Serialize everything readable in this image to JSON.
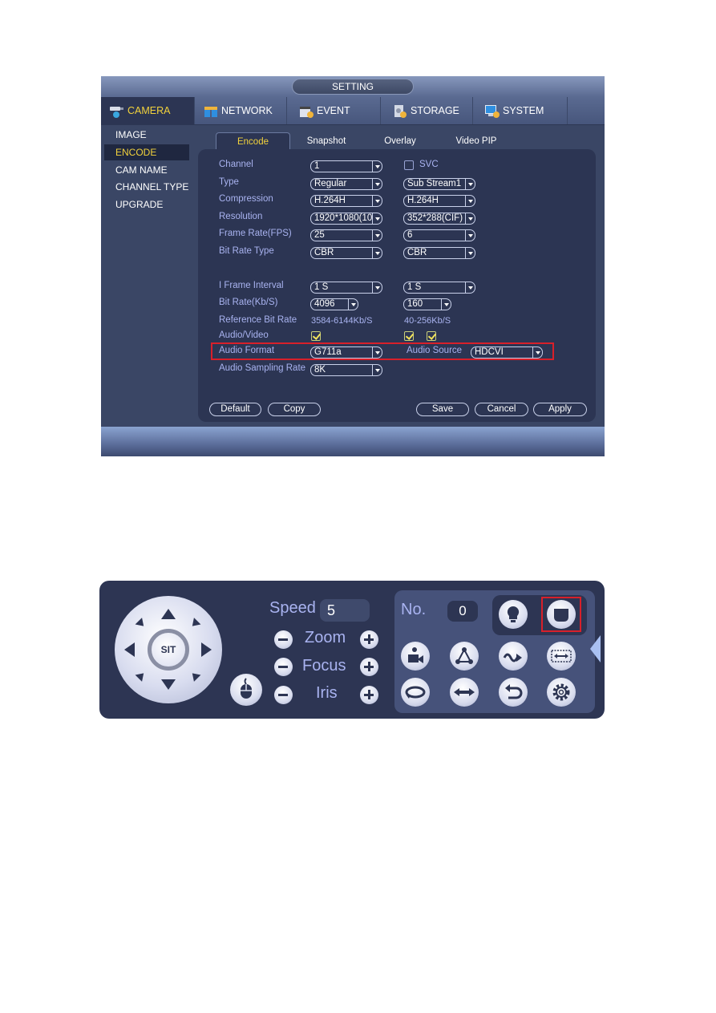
{
  "setting_window": {
    "title": "SETTING",
    "menu_tabs": [
      {
        "label": "CAMERA",
        "icon": "camera-icon",
        "active": true
      },
      {
        "label": "NETWORK",
        "icon": "network-icon",
        "active": false
      },
      {
        "label": "EVENT",
        "icon": "event-icon",
        "active": false
      },
      {
        "label": "STORAGE",
        "icon": "storage-icon",
        "active": false
      },
      {
        "label": "SYSTEM",
        "icon": "system-icon",
        "active": false
      }
    ],
    "sidebar": [
      {
        "label": "IMAGE",
        "active": false
      },
      {
        "label": "ENCODE",
        "active": true
      },
      {
        "label": "CAM NAME",
        "active": false
      },
      {
        "label": "CHANNEL TYPE",
        "active": false
      },
      {
        "label": "UPGRADE",
        "active": false
      }
    ],
    "sub_tabs": [
      {
        "label": "Encode",
        "active": true
      },
      {
        "label": "Snapshot",
        "active": false
      },
      {
        "label": "Overlay",
        "active": false
      },
      {
        "label": "Video PIP",
        "active": false
      }
    ],
    "form": {
      "channel": {
        "label": "Channel",
        "value": "1"
      },
      "svc": {
        "label": "SVC",
        "checked": false
      },
      "type": {
        "label": "Type",
        "main": "Regular",
        "sub": "Sub Stream1"
      },
      "compression": {
        "label": "Compression",
        "main": "H.264H",
        "sub": "H.264H"
      },
      "resolution": {
        "label": "Resolution",
        "main": "1920*1080(10",
        "sub": "352*288(CIF)"
      },
      "frame_rate": {
        "label": "Frame Rate(FPS)",
        "main": "25",
        "sub": "6"
      },
      "bit_rate_type": {
        "label": "Bit Rate Type",
        "main": "CBR",
        "sub": "CBR"
      },
      "i_frame_interval": {
        "label": "I Frame Interval",
        "main": "1 S",
        "sub": "1 S"
      },
      "bit_rate": {
        "label": "Bit Rate(Kb/S)",
        "main": "4096",
        "sub": "160"
      },
      "reference_bit_rate": {
        "label": "Reference Bit Rate",
        "main": "3584-6144Kb/S",
        "sub": "40-256Kb/S"
      },
      "audio_video": {
        "label": "Audio/Video",
        "main_checked": true,
        "sub_checked": [
          true,
          true
        ]
      },
      "audio_format": {
        "label": "Audio Format",
        "value": "G711a"
      },
      "audio_source": {
        "label": "Audio Source",
        "value": "HDCVI"
      },
      "audio_sampling_rate": {
        "label": "Audio Sampling Rate",
        "value": "8K"
      }
    },
    "buttons": {
      "default": "Default",
      "copy": "Copy",
      "save": "Save",
      "cancel": "Cancel",
      "apply": "Apply"
    },
    "highlight_color": "#d8202a",
    "active_color": "#f2d23c"
  },
  "ptz_panel": {
    "center_label": "SIT",
    "speed": {
      "label": "Speed",
      "value": "5"
    },
    "controls": [
      {
        "label": "Zoom"
      },
      {
        "label": "Focus"
      },
      {
        "label": "Iris"
      }
    ],
    "preset_no": {
      "label": "No.",
      "value": "0"
    },
    "function_icons": [
      "light-icon",
      "wiper-icon",
      "preset-icon",
      "tour-icon",
      "pattern-icon",
      "border-icon",
      "rotate-icon",
      "pan-icon",
      "flip-icon",
      "settings-icon"
    ]
  }
}
